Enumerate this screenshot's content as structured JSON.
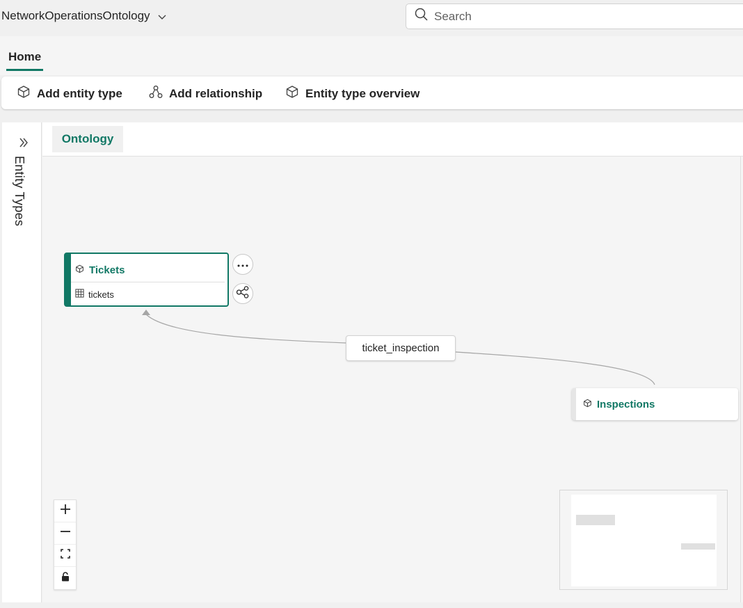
{
  "header": {
    "title": "NetworkOperationsOntology",
    "search_placeholder": "Search"
  },
  "tabs": {
    "home_label": "Home"
  },
  "toolbar": {
    "add_entity_type": "Add entity type",
    "add_relationship": "Add relationship",
    "entity_type_overview": "Entity type overview"
  },
  "sidepanel": {
    "label": "Entity Types"
  },
  "canvas": {
    "tab_label": "Ontology",
    "nodes": {
      "tickets": {
        "title": "Tickets",
        "source": "tickets"
      },
      "inspections": {
        "title": "Inspections"
      }
    },
    "edge_label": "ticket_inspection"
  },
  "colors": {
    "accent": "#117865",
    "canvas_bg": "#f5f5f5"
  },
  "icons": {
    "title_dropdown": "chevron-down-icon",
    "search": "search-icon",
    "add_entity": "cube-icon",
    "add_relationship": "relationship-icon",
    "overview": "cube-icon",
    "expand_panel": "double-chevron-right-icon",
    "entity": "cube-icon",
    "table": "table-icon",
    "more": "more-icon",
    "connect": "share-nodes-icon",
    "zoom_in": "plus-icon",
    "zoom_out": "minus-icon",
    "fit": "fit-view-icon",
    "lock": "lock-icon"
  }
}
